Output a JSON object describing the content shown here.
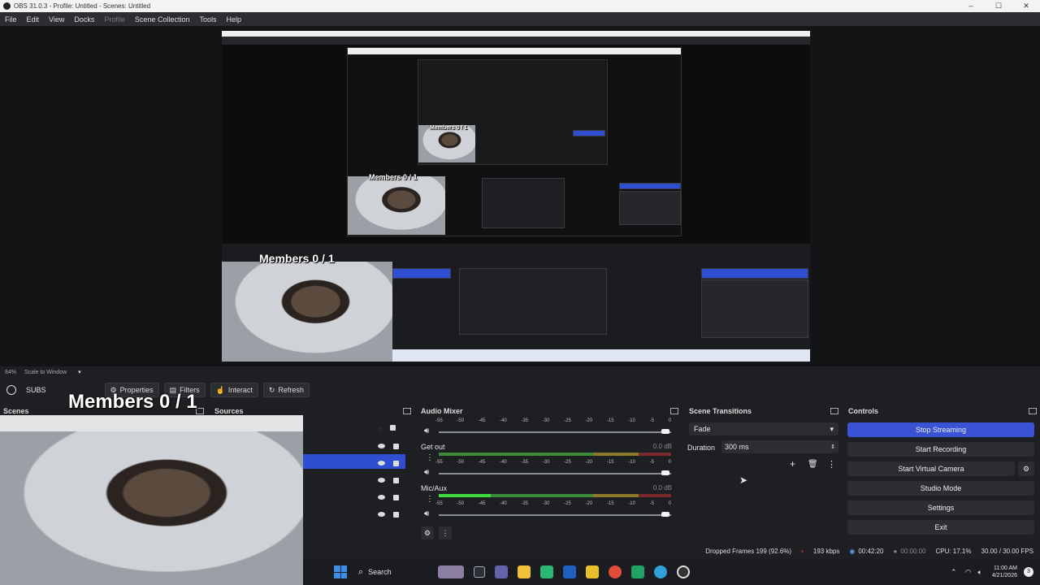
{
  "window": {
    "title": "OBS 31.0.3 - Profile: Untitled - Scenes: Untitled",
    "controls": [
      "–",
      "☐",
      "✕"
    ]
  },
  "menu": [
    "File",
    "Edit",
    "View",
    "Docks",
    "Profile",
    "Scene Collection",
    "Tools",
    "Help"
  ],
  "preview": {
    "zoom": "84%",
    "scale_mode": "Scale to Window",
    "overlay_text": "Members 0 / 1"
  },
  "source_toolbar": {
    "current_source": "SUBS",
    "properties": "Properties",
    "filters": "Filters",
    "interact": "Interact",
    "refresh": "Refresh"
  },
  "docks": {
    "scenes": {
      "title": "Scenes"
    },
    "sources": {
      "title": "Sources"
    },
    "audio_mixer": {
      "title": "Audio Mixer",
      "scale": [
        "-60",
        "-55",
        "-50",
        "-45",
        "-40",
        "-35",
        "-30",
        "-25",
        "-20",
        "-15",
        "-10",
        "-5",
        "0"
      ],
      "channels": [
        {
          "name": "",
          "level": "",
          "volume_pct": 97
        },
        {
          "name": "Get out",
          "level": "0.0 dB",
          "volume_pct": 97
        },
        {
          "name": "Mic/Aux",
          "level": "0.0 dB",
          "volume_pct": 97
        }
      ]
    },
    "scene_transitions": {
      "title": "Scene Transitions",
      "transition": "Fade",
      "duration_label": "Duration",
      "duration_value": "300 ms"
    },
    "controls": {
      "title": "Controls",
      "buttons": [
        "Stop Streaming",
        "Start Recording",
        "Start Virtual Camera",
        "Studio Mode",
        "Settings",
        "Exit"
      ]
    }
  },
  "status": {
    "dropped_frames": "Dropped Frames 199 (92.6%)",
    "bitrate": "193 kbps",
    "stream_time": "00:42:20",
    "rec_time": "00:00:00",
    "cpu": "CPU: 17.1%",
    "fps": "30.00 / 30.00 FPS"
  },
  "taskbar": {
    "search": "Search",
    "time": "11:00 AM",
    "date": "4/21/2026",
    "notif_count": "3"
  },
  "colors": {
    "accent": "#3a53d6",
    "bg": "#1e1f22",
    "panel": "#2b2d31"
  }
}
